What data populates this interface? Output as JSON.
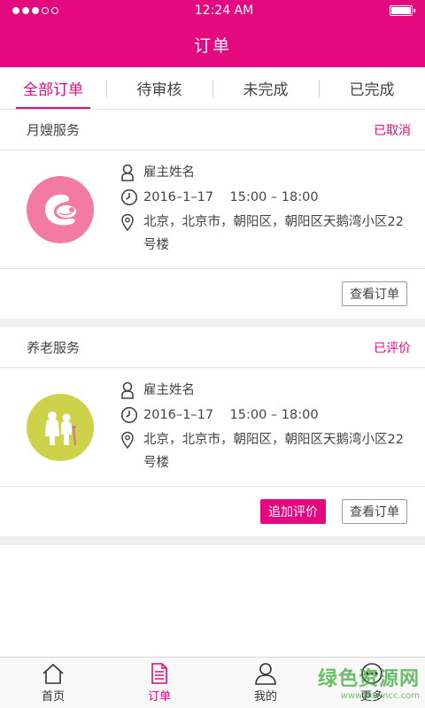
{
  "status_bar": {
    "time": "12:24 AM"
  },
  "header": {
    "title": "订单"
  },
  "tabs": [
    {
      "label": "全部订单",
      "active": true
    },
    {
      "label": "待审核"
    },
    {
      "label": "未完成"
    },
    {
      "label": "已完成"
    }
  ],
  "orders": [
    {
      "service": "月嫂服务",
      "status": "已取消",
      "avatar_color": "#f27aa3",
      "avatar_icon": "mother-baby-icon",
      "employer_name": "雇主姓名",
      "time": "2016–1–17    15:00 – 18:00",
      "address": "北京，北京市，朝阳区，朝阳区天鹅湾小区22 号楼",
      "view_button": "查看订单"
    },
    {
      "service": "养老服务",
      "status": "已评价",
      "avatar_color": "#cdd24a",
      "avatar_icon": "elderly-couple-icon",
      "employer_name": "雇主姓名",
      "time": "2016–1–17    15:00 – 18:00",
      "address": "北京，北京市，朝阳区，朝阳区天鹅湾小区22 号楼",
      "review_button": "追加评价",
      "view_button": "查看订单"
    }
  ],
  "bottom_nav": [
    {
      "label": "首页",
      "icon": "home-icon"
    },
    {
      "label": "订单",
      "icon": "order-icon",
      "active": true
    },
    {
      "label": "我的",
      "icon": "user-icon"
    },
    {
      "label": "更多",
      "icon": "more-icon"
    }
  ],
  "watermark": {
    "main": "绿色资源网",
    "sub": "www.downcc.com"
  },
  "colors": {
    "brand": "#e5097f"
  }
}
